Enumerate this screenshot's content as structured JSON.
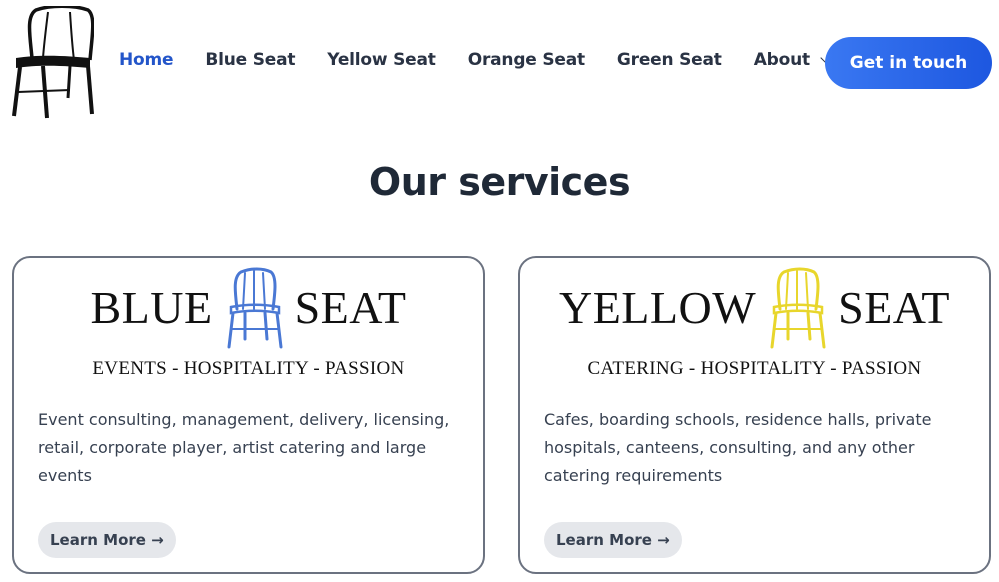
{
  "header": {
    "nav": [
      {
        "label": "Home",
        "active": true
      },
      {
        "label": "Blue Seat"
      },
      {
        "label": "Yellow Seat"
      },
      {
        "label": "Orange Seat"
      },
      {
        "label": "Green Seat"
      },
      {
        "label": "About"
      }
    ],
    "cta_label": "Get in touch"
  },
  "main": {
    "title": "Our services",
    "cards": [
      {
        "brand_left": "BLUE",
        "brand_right": "SEAT",
        "chair_color": "#4a78d4",
        "tagline": "EVENTS - HOSPITALITY - PASSION",
        "description": "Event consulting, management, delivery, licensing, retail, corporate player, artist catering and large events",
        "button_label": "Learn More →"
      },
      {
        "brand_left": "YELLOW",
        "brand_right": "SEAT",
        "chair_color": "#e8d62c",
        "tagline": "CATERING - HOSPITALITY - PASSION",
        "description": "Cafes, boarding schools, residence halls, private hospitals, canteens, consulting, and any other catering requirements",
        "button_label": "Learn More →"
      }
    ]
  },
  "colors": {
    "accent": "#2355c9",
    "cta_start": "#3a78f2",
    "cta_end": "#1d57e0"
  }
}
